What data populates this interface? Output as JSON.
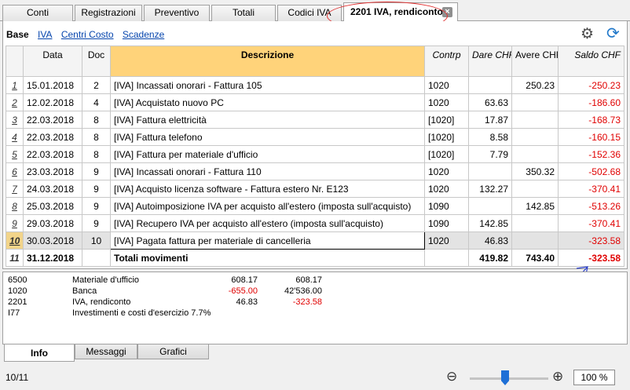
{
  "tabs": [
    {
      "label": "Conti"
    },
    {
      "label": "Registrazioni"
    },
    {
      "label": "Preventivo"
    },
    {
      "label": "Totali"
    },
    {
      "label": "Codici IVA"
    },
    {
      "label": "2201 IVA, rendiconto"
    }
  ],
  "tab_close_symbol": "×",
  "subnav": {
    "base": "Base",
    "links": [
      "IVA",
      "Centri Costo",
      "Scadenze"
    ]
  },
  "icons": {
    "settings": "gear-icon",
    "refresh": "refresh-icon"
  },
  "table": {
    "headers": [
      "Data",
      "Doc",
      "Descrizione",
      "Contrp",
      "Dare CHF",
      "Avere CHF",
      "Saldo CHF"
    ],
    "rows": [
      {
        "n": "1",
        "date": "15.01.2018",
        "doc": "2",
        "desc": "[IVA] Incassati onorari - Fattura 105",
        "contrp": "1020",
        "dare": "",
        "avere": "250.23",
        "saldo": "-250.23"
      },
      {
        "n": "2",
        "date": "12.02.2018",
        "doc": "4",
        "desc": "[IVA] Acquistato nuovo PC",
        "contrp": "1020",
        "dare": "63.63",
        "avere": "",
        "saldo": "-186.60"
      },
      {
        "n": "3",
        "date": "22.03.2018",
        "doc": "8",
        "desc": "[IVA] Fattura elettricità",
        "contrp": "[1020]",
        "dare": "17.87",
        "avere": "",
        "saldo": "-168.73"
      },
      {
        "n": "4",
        "date": "22.03.2018",
        "doc": "8",
        "desc": "[IVA] Fattura telefono",
        "contrp": "[1020]",
        "dare": "8.58",
        "avere": "",
        "saldo": "-160.15"
      },
      {
        "n": "5",
        "date": "22.03.2018",
        "doc": "8",
        "desc": "[IVA] Fattura per materiale d'ufficio",
        "contrp": "[1020]",
        "dare": "7.79",
        "avere": "",
        "saldo": "-152.36"
      },
      {
        "n": "6",
        "date": "23.03.2018",
        "doc": "9",
        "desc": "[IVA] Incassati onorari - Fattura 110",
        "contrp": "1020",
        "dare": "",
        "avere": "350.32",
        "saldo": "-502.68"
      },
      {
        "n": "7",
        "date": "24.03.2018",
        "doc": "9",
        "desc": "[IVA] Acquisto licenza software - Fattura estero Nr. E123",
        "contrp": "1020",
        "dare": "132.27",
        "avere": "",
        "saldo": "-370.41"
      },
      {
        "n": "8",
        "date": "25.03.2018",
        "doc": "9",
        "desc": "[IVA] Autoimposizione IVA per acquisto all'estero (imposta sull'acquisto)",
        "contrp": "1090",
        "dare": "",
        "avere": "142.85",
        "saldo": "-513.26"
      },
      {
        "n": "9",
        "date": "29.03.2018",
        "doc": "9",
        "desc": "[IVA] Recupero IVA per acquisto all'estero (imposta sull'acquisto)",
        "contrp": "1090",
        "dare": "142.85",
        "avere": "",
        "saldo": "-370.41"
      },
      {
        "n": "10",
        "date": "30.03.2018",
        "doc": "10",
        "desc": "[IVA] Pagata fattura per materiale di cancelleria",
        "contrp": "1020",
        "dare": "46.83",
        "avere": "",
        "saldo": "-323.58"
      }
    ],
    "total": {
      "n": "11",
      "date": "31.12.2018",
      "doc": "",
      "desc": "Totali movimenti",
      "contrp": "",
      "dare": "419.82",
      "avere": "743.40",
      "saldo": "-323.58"
    }
  },
  "info": {
    "rows": [
      {
        "code": "6500",
        "desc": "Materiale d'ufficio",
        "v1": "608.17",
        "v2": "608.17",
        "v1_neg": false,
        "v2_neg": false
      },
      {
        "code": "1020",
        "desc": "Banca",
        "v1": "-655.00",
        "v2": "42'536.00",
        "v1_neg": true,
        "v2_neg": false
      },
      {
        "code": "2201",
        "desc": "IVA, rendiconto",
        "v1": "46.83",
        "v2": "-323.58",
        "v1_neg": false,
        "v2_neg": true
      },
      {
        "code": "I77",
        "desc": "Investimenti e costi d'esercizio 7.7%",
        "v1": "",
        "v2": "",
        "v1_neg": false,
        "v2_neg": false
      }
    ]
  },
  "bottom_tabs": [
    "Info",
    "Messaggi",
    "Grafici"
  ],
  "status": {
    "record_count": "10/11",
    "zoom": "100 %",
    "zoom_level": 0.45
  },
  "colors": {
    "negative": "#e00000",
    "highlight": "#ffd37a",
    "accent": "#1e6fd6",
    "annotation": "#e03030",
    "arrow": "#2a3fc8"
  }
}
